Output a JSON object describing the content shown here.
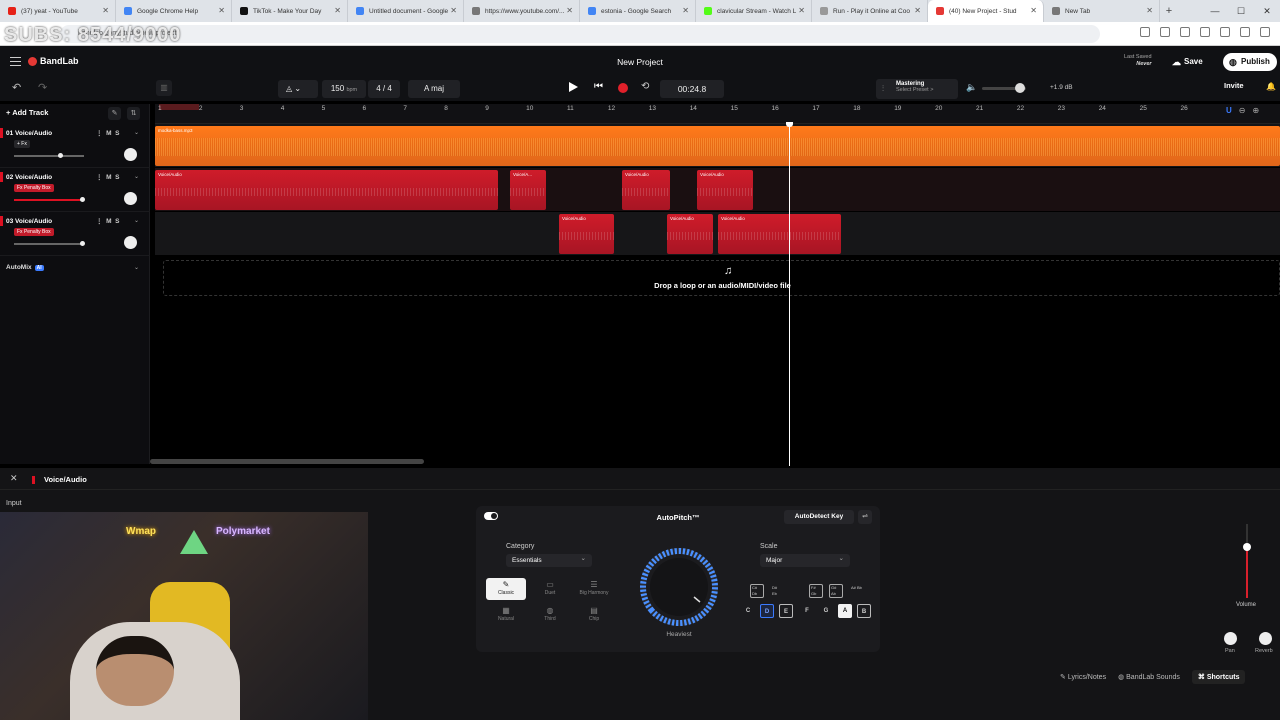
{
  "browser": {
    "tabs": [
      {
        "label": "(37) yeat - YouTube",
        "color": "#e62117",
        "active": false
      },
      {
        "label": "Google Chrome Help",
        "color": "#4285f4",
        "active": false
      },
      {
        "label": "TikTok - Make Your Day",
        "color": "#111111",
        "active": false
      },
      {
        "label": "Untitled document - Google",
        "color": "#4285f4",
        "active": false
      },
      {
        "label": "https://www.youtube.com/...",
        "color": "#777777",
        "active": false
      },
      {
        "label": "estonia - Google Search",
        "color": "#4285f4",
        "active": false
      },
      {
        "label": "clavicular Stream - Watch L",
        "color": "#53fc18",
        "active": false
      },
      {
        "label": "Run - Play it Online at Coo",
        "color": "#999999",
        "active": false
      },
      {
        "label": "(40) New Project - Stud",
        "color": "#e53935",
        "active": true
      },
      {
        "label": "New Tab",
        "color": "#777777",
        "active": false
      }
    ],
    "url": "bandlab.com/studio/new project",
    "watermark": "SUBS: 8544/9000"
  },
  "header": {
    "logo": "BandLab",
    "project_title": "New Project",
    "last_saved_label": "Last Saved",
    "last_saved_value": "Never",
    "save": "Save",
    "publish": "Publish"
  },
  "transport": {
    "tempo": "150",
    "tempo_unit": "bpm",
    "time_signature": "4 / 4",
    "key": "A maj",
    "time": "00:24.8",
    "mastering": "Mastering",
    "mastering_preset": "Select Preset >",
    "gain": "+1.9 dB",
    "invite": "Invite"
  },
  "tracklist": {
    "add_track": "Add Track",
    "tracks": [
      {
        "num": "01",
        "name": "Voice/Audio",
        "fx": "+ Fx",
        "fx_color": "#26262a",
        "vol": 0.62
      },
      {
        "num": "02",
        "name": "Voice/Audio",
        "fx": "Fx Penalty Box",
        "fx_color": "#c21b2a",
        "vol": 0.9
      },
      {
        "num": "03",
        "name": "Voice/Audio",
        "fx": "Fx Penalty Box",
        "fx_color": "#c21b2a",
        "vol": 0.9
      }
    ],
    "automix": "AutoMix",
    "automix_badge": "AI"
  },
  "timeline": {
    "bars": [
      "1",
      "2",
      "3",
      "4",
      "5",
      "6",
      "7",
      "8",
      "9",
      "10",
      "11",
      "12",
      "13",
      "14",
      "15",
      "16",
      "17",
      "18",
      "19",
      "20",
      "21",
      "22",
      "23",
      "24",
      "25",
      "26"
    ],
    "lane1_clips": [
      {
        "label": "modka-bass.mp3"
      }
    ],
    "lane2_clips": [
      {
        "label": "Voice/Audio"
      },
      {
        "label": "Voice/A..."
      },
      {
        "label": "Voice/Audio"
      },
      {
        "label": "Voice/Audio"
      }
    ],
    "lane3_clips": [
      {
        "label": "Voice/Audio"
      },
      {
        "label": "Voice/Audio"
      },
      {
        "label": "Voice/Audio"
      }
    ],
    "drop_text": "Drop a loop or an audio/MIDI/video file"
  },
  "panel": {
    "title": "Voice/Audio",
    "input_label": "Input",
    "webcam_sign1": "Wmap",
    "webcam_sign2": "Polymarket",
    "autopitch": {
      "title": "AutoPitch™",
      "autodetect": "AutoDetect Key",
      "category_label": "Category",
      "category_value": "Essentials",
      "presets": [
        {
          "label": "Classic",
          "selected": true
        },
        {
          "label": "Duet",
          "selected": false
        },
        {
          "label": "Big Harmony",
          "selected": false
        },
        {
          "label": "Natural",
          "selected": false
        },
        {
          "label": "Third",
          "selected": false
        },
        {
          "label": "Chip",
          "selected": false
        }
      ],
      "knob_label": "Heaviest",
      "scale_label": "Scale",
      "scale_value": "Major",
      "sharps": [
        "C# Db",
        "D# Eb",
        "F# Gb",
        "G# Ab",
        "A# Bb"
      ],
      "naturals": [
        "C",
        "D",
        "E",
        "F",
        "G",
        "A",
        "B"
      ]
    },
    "volume_label": "Volume",
    "pan_label": "Pan",
    "reverb_label": "Reverb"
  },
  "footer": {
    "lyrics": "Lyrics/Notes",
    "sounds": "BandLab Sounds",
    "shortcuts": "Shortcuts"
  }
}
